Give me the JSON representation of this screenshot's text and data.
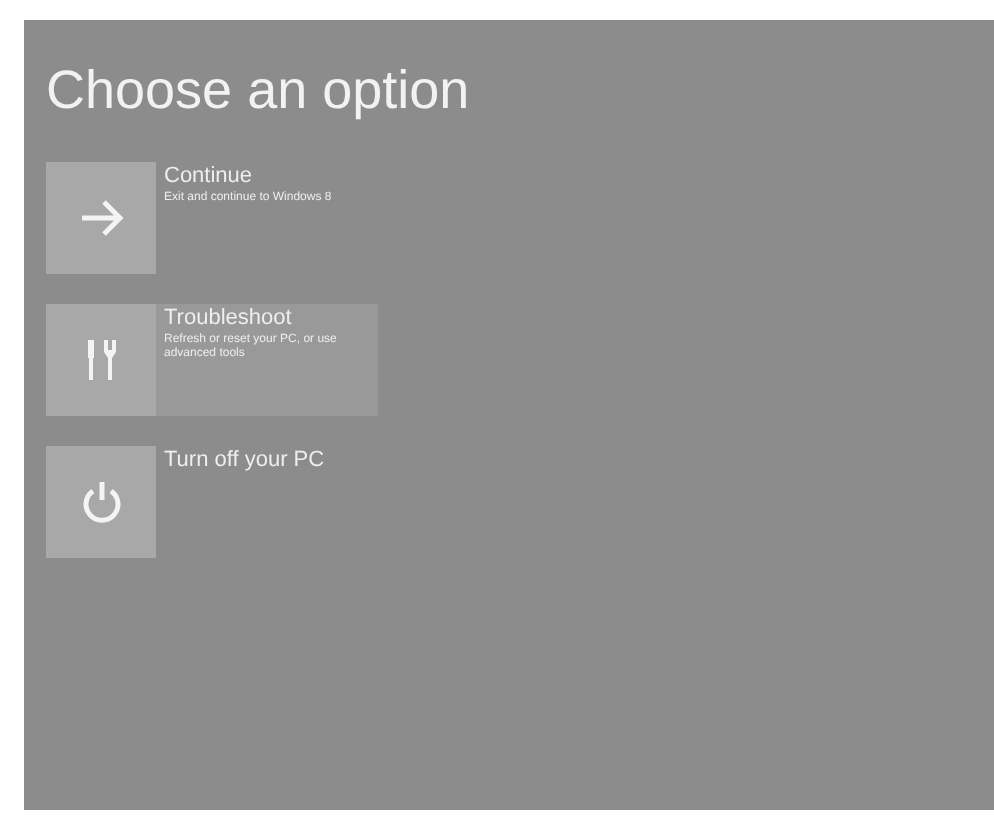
{
  "title": "Choose an option",
  "options": [
    {
      "kind": "continue",
      "label": "Continue",
      "description": "Exit and continue to Windows 8",
      "selected": false
    },
    {
      "kind": "troubleshoot",
      "label": "Troubleshoot",
      "description": "Refresh or reset your PC, or use advanced tools",
      "selected": true
    },
    {
      "kind": "power",
      "label": "Turn off your PC",
      "selected": false
    }
  ]
}
